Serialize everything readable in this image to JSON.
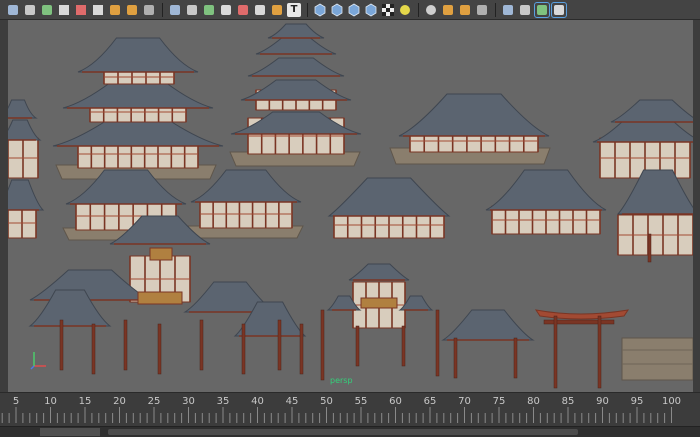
{
  "toolbar": {
    "icons": [
      "select-icon",
      "lasso-icon",
      "paint-select-icon",
      "magnet-snap-icon",
      "curve-snap-icon",
      "point-snap-icon",
      "render-icon",
      "ipr-icon",
      "render-settings-icon",
      "camera-attr-icon",
      "image-plane-icon",
      "bookmark-icon",
      "grid-icon",
      "film-gate-icon",
      "resolution-gate-icon",
      "safe-action-icon",
      "text-icon",
      "wireframe-icon",
      "smooth-shade-icon",
      "wireframe-on-shaded-icon",
      "textured-icon",
      "checker-icon",
      "light-icon",
      "shadows-icon",
      "ambient-occlusion-icon",
      "motion-blur-icon",
      "anti-alias-icon",
      "isolate-icon",
      "xray-icon",
      "xray-joints-icon",
      "frame-selection-icon"
    ],
    "text_icon_label": "T"
  },
  "viewport": {
    "camera_label": "persp",
    "background": "#676767"
  },
  "timeline": {
    "ticks": [
      "5",
      "10",
      "15",
      "20",
      "25",
      "30",
      "35",
      "40",
      "45",
      "50",
      "55",
      "60",
      "65",
      "70",
      "75",
      "80",
      "85",
      "90",
      "95",
      "100"
    ]
  },
  "colors": {
    "roof": "#5b6470",
    "roof_dark": "#3f4650",
    "wall": "#d8cdbd",
    "wood": "#7a3524",
    "wood_light": "#a24a33",
    "base": "#8a7e6d",
    "axis_x": "#e84b4b",
    "axis_y": "#4bd36b",
    "axis_z": "#4b7be8"
  }
}
